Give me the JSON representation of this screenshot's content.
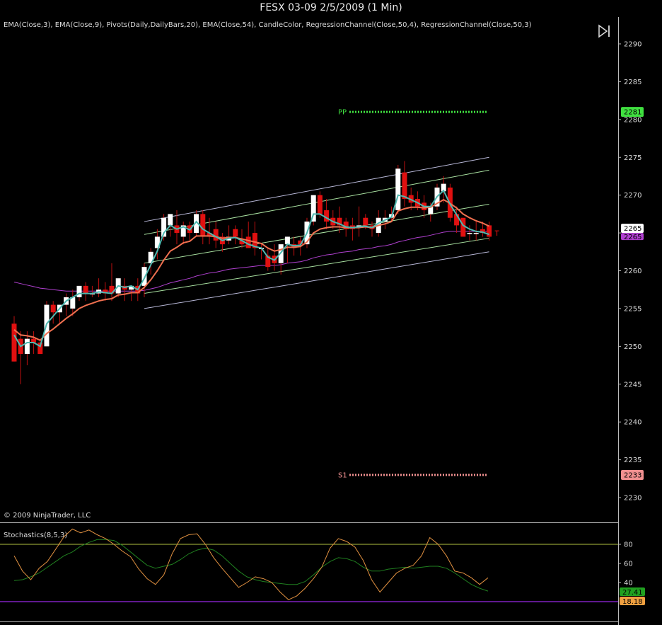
{
  "title": "FESX 03-09  2/5/2009 (1 Min)",
  "indicators_text": "EMA(Close,3), EMA(Close,9), Pivots(Daily,DailyBars,20), EMA(Close,54), CandleColor, RegressionChannel(Close,50,4), RegressionChannel(Close,50,3)",
  "copyright": "© 2009 NinjaTrader, LLC",
  "stochastics_label": "Stochastics(8,5,3)",
  "colors": {
    "up_candle": "#ffffff",
    "down_candle": "#e01010",
    "wick": "#c01010",
    "ema3": "#4fb8b0",
    "ema9": "#f07050",
    "ema54": "#b040d0",
    "channel_outer": "#b8b8d8",
    "channel_inner": "#a8e0a0",
    "pp": "#40e040",
    "s1": "#f09090",
    "stoch_k": "#e09040",
    "stoch_d": "#208020",
    "stoch_upper": "#b0c040",
    "stoch_lower": "#8020c0"
  },
  "chart_data": [
    {
      "type": "candlestick",
      "title": "FESX 03-09  2/5/2009 (1 Min)",
      "ylim": [
        2228,
        2292
      ],
      "yticks": [
        2290,
        2285,
        2280,
        2275,
        2270,
        2265,
        2260,
        2255,
        2250,
        2245,
        2240,
        2235,
        2230
      ],
      "candles": [
        {
          "o": 2253.0,
          "h": 2254.0,
          "l": 2248.0,
          "c": 2248.0
        },
        {
          "o": 2251.0,
          "h": 2252.0,
          "l": 2245.0,
          "c": 2249.0
        },
        {
          "o": 2249.0,
          "h": 2252.0,
          "l": 2247.5,
          "c": 2251.0
        },
        {
          "o": 2251.0,
          "h": 2252.0,
          "l": 2249.0,
          "c": 2250.5
        },
        {
          "o": 2250.5,
          "h": 2251.0,
          "l": 2249.0,
          "c": 2249.0
        },
        {
          "o": 2250.0,
          "h": 2256.0,
          "l": 2250.0,
          "c": 2255.5
        },
        {
          "o": 2255.5,
          "h": 2256.0,
          "l": 2253.0,
          "c": 2254.5
        },
        {
          "o": 2254.5,
          "h": 2255.5,
          "l": 2253.0,
          "c": 2255.5
        },
        {
          "o": 2255.5,
          "h": 2257.0,
          "l": 2254.0,
          "c": 2256.5
        },
        {
          "o": 2255.0,
          "h": 2257.5,
          "l": 2254.0,
          "c": 2256.5
        },
        {
          "o": 2256.5,
          "h": 2258.0,
          "l": 2256.0,
          "c": 2258.0
        },
        {
          "o": 2258.0,
          "h": 2258.5,
          "l": 2256.0,
          "c": 2257.0
        },
        {
          "o": 2257.0,
          "h": 2258.0,
          "l": 2256.5,
          "c": 2257.0
        },
        {
          "o": 2257.0,
          "h": 2259.0,
          "l": 2256.5,
          "c": 2257.5
        },
        {
          "o": 2257.5,
          "h": 2258.5,
          "l": 2256.0,
          "c": 2257.0
        },
        {
          "o": 2258.0,
          "h": 2261.0,
          "l": 2256.0,
          "c": 2257.0
        },
        {
          "o": 2257.0,
          "h": 2259.0,
          "l": 2256.5,
          "c": 2259.0
        },
        {
          "o": 2258.0,
          "h": 2259.0,
          "l": 2256.0,
          "c": 2257.5
        },
        {
          "o": 2257.5,
          "h": 2258.0,
          "l": 2256.0,
          "c": 2258.0
        },
        {
          "o": 2258.0,
          "h": 2259.0,
          "l": 2256.0,
          "c": 2257.0
        },
        {
          "o": 2258.0,
          "h": 2261.0,
          "l": 2256.5,
          "c": 2260.5
        },
        {
          "o": 2261.0,
          "h": 2263.0,
          "l": 2259.5,
          "c": 2262.5
        },
        {
          "o": 2263.0,
          "h": 2265.5,
          "l": 2261.5,
          "c": 2264.5
        },
        {
          "o": 2264.5,
          "h": 2267.5,
          "l": 2264.0,
          "c": 2267.0
        },
        {
          "o": 2266.0,
          "h": 2267.5,
          "l": 2264.5,
          "c": 2267.5
        },
        {
          "o": 2266.0,
          "h": 2268.0,
          "l": 2263.5,
          "c": 2265.0
        },
        {
          "o": 2264.5,
          "h": 2266.5,
          "l": 2263.5,
          "c": 2266.0
        },
        {
          "o": 2266.0,
          "h": 2266.5,
          "l": 2264.0,
          "c": 2265.0
        },
        {
          "o": 2265.0,
          "h": 2268.0,
          "l": 2264.5,
          "c": 2267.5
        },
        {
          "o": 2267.5,
          "h": 2268.0,
          "l": 2263.5,
          "c": 2264.5
        },
        {
          "o": 2265.0,
          "h": 2267.0,
          "l": 2263.5,
          "c": 2264.5
        },
        {
          "o": 2265.5,
          "h": 2266.5,
          "l": 2263.0,
          "c": 2264.0
        },
        {
          "o": 2264.5,
          "h": 2265.0,
          "l": 2262.5,
          "c": 2263.5
        },
        {
          "o": 2264.0,
          "h": 2266.0,
          "l": 2263.5,
          "c": 2264.5
        },
        {
          "o": 2265.5,
          "h": 2266.0,
          "l": 2263.5,
          "c": 2264.5
        },
        {
          "o": 2264.0,
          "h": 2265.5,
          "l": 2263.0,
          "c": 2263.5
        },
        {
          "o": 2264.5,
          "h": 2266.5,
          "l": 2263.0,
          "c": 2263.0
        },
        {
          "o": 2265.0,
          "h": 2266.5,
          "l": 2262.0,
          "c": 2263.0
        },
        {
          "o": 2263.0,
          "h": 2263.5,
          "l": 2261.5,
          "c": 2263.0
        },
        {
          "o": 2262.0,
          "h": 2263.0,
          "l": 2260.0,
          "c": 2260.5
        },
        {
          "o": 2262.0,
          "h": 2263.5,
          "l": 2260.0,
          "c": 2261.0
        },
        {
          "o": 2261.0,
          "h": 2263.5,
          "l": 2259.5,
          "c": 2263.5
        },
        {
          "o": 2263.5,
          "h": 2264.5,
          "l": 2261.0,
          "c": 2264.5
        },
        {
          "o": 2263.5,
          "h": 2264.5,
          "l": 2262.0,
          "c": 2263.0
        },
        {
          "o": 2264.0,
          "h": 2264.5,
          "l": 2262.0,
          "c": 2263.5
        },
        {
          "o": 2263.5,
          "h": 2267.0,
          "l": 2263.0,
          "c": 2266.5
        },
        {
          "o": 2266.5,
          "h": 2270.0,
          "l": 2266.0,
          "c": 2270.0
        },
        {
          "o": 2270.0,
          "h": 2270.5,
          "l": 2267.0,
          "c": 2267.5
        },
        {
          "o": 2268.0,
          "h": 2269.5,
          "l": 2265.5,
          "c": 2266.5
        },
        {
          "o": 2267.0,
          "h": 2268.0,
          "l": 2265.5,
          "c": 2266.0
        },
        {
          "o": 2267.0,
          "h": 2268.5,
          "l": 2265.0,
          "c": 2266.0
        },
        {
          "o": 2266.5,
          "h": 2267.0,
          "l": 2264.5,
          "c": 2265.5
        },
        {
          "o": 2266.0,
          "h": 2267.0,
          "l": 2264.0,
          "c": 2265.5
        },
        {
          "o": 2266.0,
          "h": 2268.5,
          "l": 2264.5,
          "c": 2266.0
        },
        {
          "o": 2267.0,
          "h": 2267.5,
          "l": 2265.5,
          "c": 2266.0
        },
        {
          "o": 2266.0,
          "h": 2266.5,
          "l": 2264.5,
          "c": 2265.5
        },
        {
          "o": 2265.0,
          "h": 2268.0,
          "l": 2264.5,
          "c": 2267.0
        },
        {
          "o": 2266.5,
          "h": 2268.0,
          "l": 2265.5,
          "c": 2267.0
        },
        {
          "o": 2267.0,
          "h": 2268.5,
          "l": 2266.5,
          "c": 2267.5
        },
        {
          "o": 2268.0,
          "h": 2274.0,
          "l": 2267.5,
          "c": 2273.5
        },
        {
          "o": 2273.0,
          "h": 2274.5,
          "l": 2268.5,
          "c": 2269.5
        },
        {
          "o": 2270.0,
          "h": 2271.0,
          "l": 2268.0,
          "c": 2269.0
        },
        {
          "o": 2269.5,
          "h": 2270.5,
          "l": 2268.0,
          "c": 2268.5
        },
        {
          "o": 2269.0,
          "h": 2270.0,
          "l": 2267.0,
          "c": 2268.0
        },
        {
          "o": 2267.5,
          "h": 2269.0,
          "l": 2266.5,
          "c": 2268.5
        },
        {
          "o": 2268.5,
          "h": 2271.5,
          "l": 2268.0,
          "c": 2271.0
        },
        {
          "o": 2270.5,
          "h": 2272.5,
          "l": 2269.0,
          "c": 2271.5
        },
        {
          "o": 2271.0,
          "h": 2271.5,
          "l": 2266.5,
          "c": 2267.0
        },
        {
          "o": 2267.5,
          "h": 2268.5,
          "l": 2265.0,
          "c": 2266.0
        },
        {
          "o": 2267.0,
          "h": 2267.0,
          "l": 2264.5,
          "c": 2264.5
        },
        {
          "o": 2265.0,
          "h": 2266.0,
          "l": 2264.0,
          "c": 2265.0
        },
        {
          "o": 2265.0,
          "h": 2266.5,
          "l": 2264.0,
          "c": 2265.0
        },
        {
          "o": 2265.5,
          "h": 2266.5,
          "l": 2264.5,
          "c": 2265.0
        },
        {
          "o": 2266.0,
          "h": 2266.5,
          "l": 2264.0,
          "c": 2264.5
        }
      ],
      "series": [
        {
          "name": "EMA(Close,3)",
          "color_key": "ema3",
          "values": [
            2251.5,
            2250,
            2250.5,
            2250.5,
            2250,
            2253,
            2254,
            2255,
            2256,
            2256.5,
            2257,
            2257,
            2257,
            2257.2,
            2257.1,
            2257,
            2258,
            2257.8,
            2258,
            2257.5,
            2259,
            2260.8,
            2262.6,
            2265,
            2266,
            2265.5,
            2265.8,
            2265.4,
            2266.5,
            2265.5,
            2265,
            2264.5,
            2264,
            2264.3,
            2264.4,
            2264,
            2263.5,
            2263.2,
            2263,
            2261.8,
            2261.4,
            2262.4,
            2263.5,
            2263.3,
            2263.4,
            2265,
            2267.5,
            2267.5,
            2267,
            2266.5,
            2266.2,
            2265.8,
            2265.7,
            2265.8,
            2265.9,
            2265.7,
            2266.3,
            2266.7,
            2267.1,
            2270,
            2269.8,
            2269.4,
            2269,
            2268.5,
            2268.5,
            2269.8,
            2270.6,
            2268.8,
            2267.4,
            2266,
            2265.5,
            2265.2,
            2265.1,
            2264.8
          ]
        },
        {
          "name": "EMA(Close,9)",
          "color_key": "ema9",
          "values": [
            2252.2,
            2251.5,
            2251.4,
            2251.2,
            2250.8,
            2251.7,
            2252.3,
            2253,
            2253.7,
            2254.3,
            2255,
            2255.4,
            2255.7,
            2256,
            2256.2,
            2256.3,
            2256.8,
            2256.9,
            2257.1,
            2257.1,
            2257.8,
            2258.8,
            2260,
            2261.4,
            2262.6,
            2263.1,
            2263.7,
            2263.9,
            2264.6,
            2264.6,
            2264.6,
            2264.5,
            2264.3,
            2264.4,
            2264.4,
            2264.2,
            2264,
            2263.8,
            2263.6,
            2263,
            2262.6,
            2262.8,
            2263.1,
            2263.1,
            2263.2,
            2263.8,
            2265,
            2265.5,
            2265.7,
            2265.8,
            2265.8,
            2265.7,
            2265.7,
            2265.7,
            2265.8,
            2265.7,
            2266,
            2266.2,
            2266.5,
            2267.9,
            2268.2,
            2268.4,
            2268.4,
            2268.3,
            2268.4,
            2268.9,
            2269.4,
            2268.9,
            2268.3,
            2267.5,
            2267,
            2266.6,
            2266.3,
            2265.9
          ]
        },
        {
          "name": "EMA(Close,54)",
          "color_key": "ema54",
          "values": [
            2258.5,
            2258.3,
            2258.1,
            2257.9,
            2257.7,
            2257.6,
            2257.5,
            2257.4,
            2257.3,
            2257.3,
            2257.3,
            2257.3,
            2257.3,
            2257.3,
            2257.3,
            2257.3,
            2257.3,
            2257.3,
            2257.3,
            2257.3,
            2257.4,
            2257.6,
            2257.8,
            2258.1,
            2258.4,
            2258.6,
            2258.8,
            2259,
            2259.3,
            2259.5,
            2259.7,
            2259.8,
            2260,
            2260.2,
            2260.3,
            2260.4,
            2260.5,
            2260.6,
            2260.7,
            2260.7,
            2260.7,
            2260.8,
            2261,
            2261.1,
            2261.2,
            2261.4,
            2261.7,
            2261.9,
            2262.1,
            2262.2,
            2262.4,
            2262.5,
            2262.6,
            2262.8,
            2262.9,
            2263,
            2263.2,
            2263.3,
            2263.5,
            2263.8,
            2264,
            2264.2,
            2264.4,
            2264.5,
            2264.7,
            2264.9,
            2265.1,
            2265.2,
            2265.2,
            2265.2,
            2265.2,
            2265.2,
            2265.2,
            2265.2
          ]
        }
      ],
      "regression_channel_outer": {
        "start_index": 20,
        "end_index": 73,
        "upper": [
          2266.5,
          2275.0
        ],
        "lower": [
          2255.0,
          2262.5
        ]
      },
      "regression_channel_inner": {
        "start_index": 20,
        "end_index": 73,
        "upper": [
          2264.8,
          2273.3
        ],
        "mid": [
          2261.0,
          2268.8
        ],
        "lower": [
          2257.0,
          2264.3
        ]
      },
      "pivots": [
        {
          "label": "PP",
          "value": 2281,
          "badge": "2281",
          "color_key": "pp"
        },
        {
          "label": "S1",
          "value": 2233,
          "badge": "2233",
          "color_key": "s1"
        }
      ],
      "last_price_badge": "2265",
      "ema54_badge": "2265"
    },
    {
      "type": "line",
      "title": "Stochastics(8,5,3)",
      "ylim": [
        0,
        100
      ],
      "yticks": [
        80,
        60,
        40
      ],
      "levels": [
        80,
        20
      ],
      "series": [
        {
          "name": "K",
          "color_key": "stoch_k",
          "values": [
            68,
            52,
            43,
            55,
            62,
            75,
            88,
            96,
            92,
            95,
            90,
            86,
            80,
            73,
            67,
            54,
            44,
            38,
            48,
            70,
            86,
            90,
            91,
            80,
            66,
            55,
            45,
            35,
            40,
            46,
            44,
            40,
            30,
            22,
            26,
            34,
            44,
            56,
            76,
            86,
            83,
            77,
            63,
            43,
            30,
            40,
            50,
            55,
            58,
            68,
            87,
            80,
            68,
            52,
            50,
            45,
            38,
            45
          ]
        },
        {
          "name": "D",
          "color_key": "stoch_d",
          "values": [
            42,
            43,
            46,
            50,
            56,
            62,
            68,
            72,
            78,
            82,
            85,
            85,
            84,
            79,
            72,
            65,
            58,
            55,
            57,
            59,
            64,
            70,
            74,
            76,
            74,
            68,
            60,
            52,
            46,
            43,
            41,
            40,
            39,
            38,
            38,
            41,
            48,
            56,
            62,
            66,
            65,
            62,
            56,
            52,
            52,
            54,
            55,
            56,
            55,
            56,
            57,
            57,
            55,
            50,
            44,
            38,
            34,
            31
          ]
        }
      ],
      "badges": [
        {
          "value": "27.41",
          "color_key": "stoch_d"
        },
        {
          "value": "18.18",
          "color_key": "stoch_k"
        }
      ]
    }
  ]
}
